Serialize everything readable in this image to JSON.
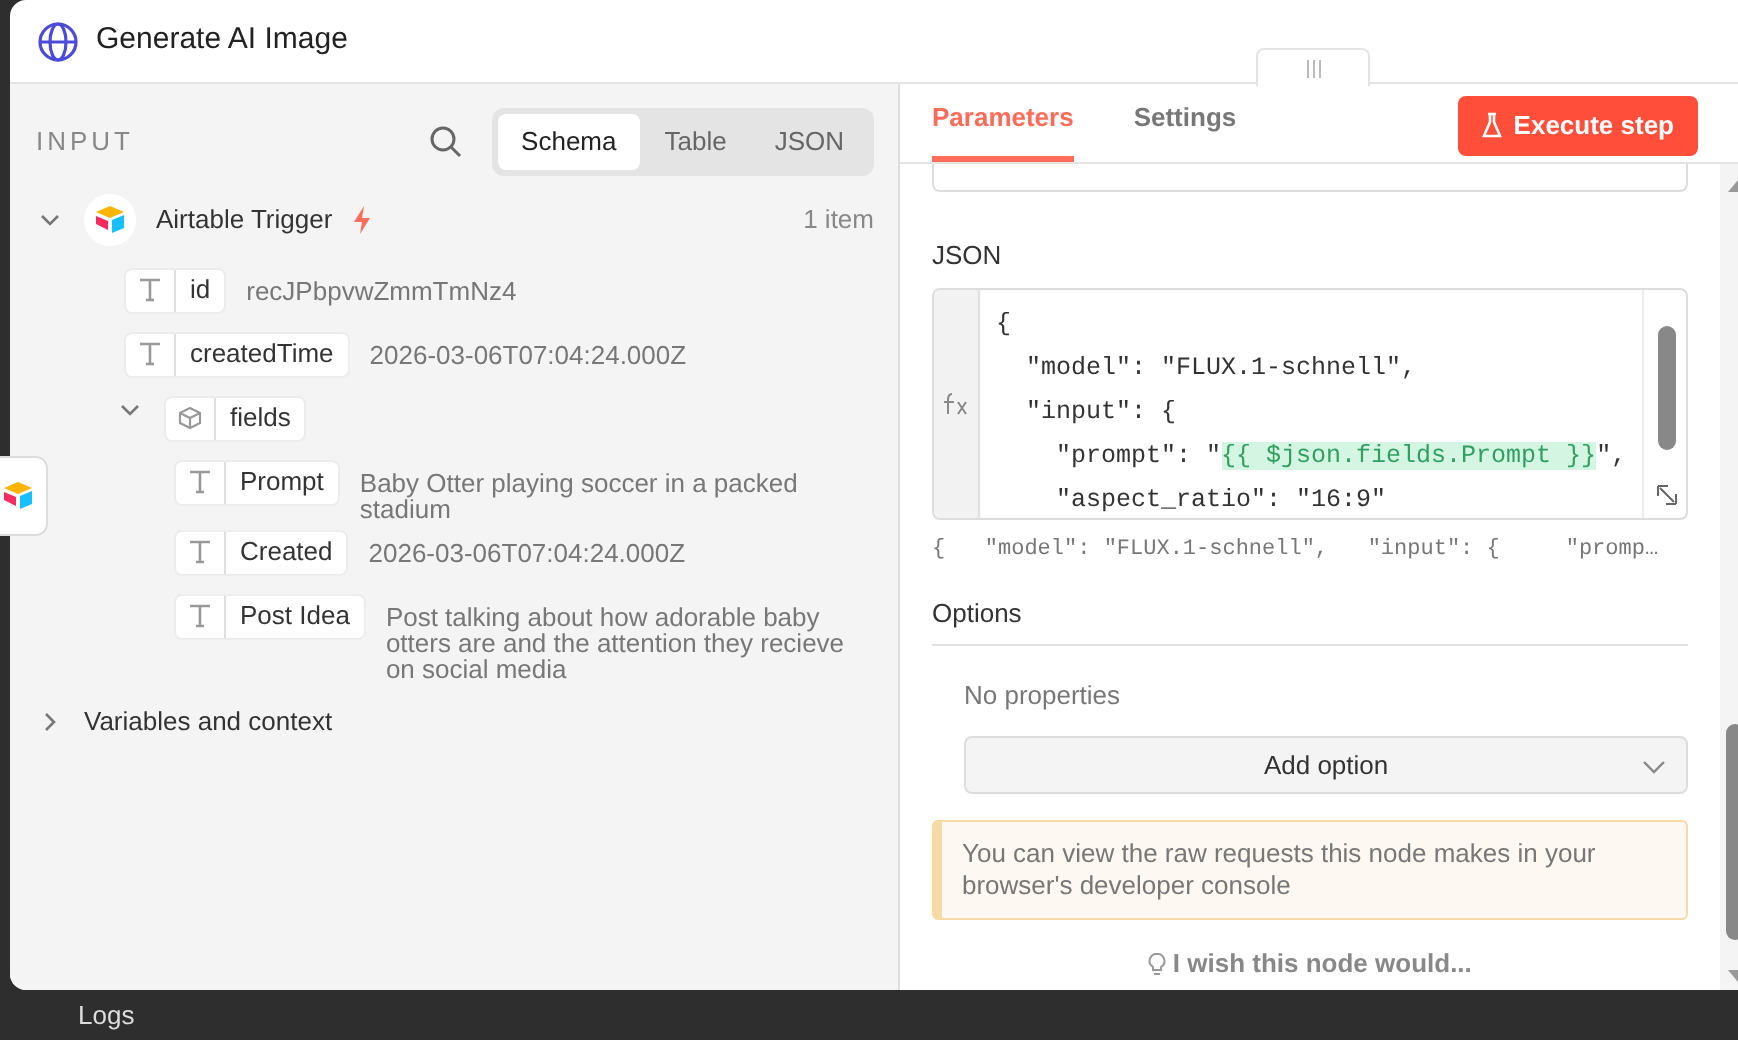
{
  "window": {
    "title": "Generate AI Image"
  },
  "input_panel": {
    "heading": "INPUT",
    "view_tabs": [
      {
        "label": "Schema",
        "selected": true
      },
      {
        "label": "Table",
        "selected": false
      },
      {
        "label": "JSON",
        "selected": false
      }
    ],
    "tree": [
      {
        "kind": "node",
        "label": "Airtable Trigger",
        "count": "1 item",
        "expanded": true,
        "children": [
          {
            "kind": "string",
            "key": "id",
            "value": "recJPbpvwZmmTmNz4"
          },
          {
            "kind": "string",
            "key": "createdTime",
            "value": "2026-03-06T07:04:24.000Z"
          },
          {
            "kind": "object",
            "key": "fields",
            "expanded": true,
            "children": [
              {
                "kind": "string",
                "key": "Prompt",
                "value": "Baby Otter playing soccer in a packed stadium"
              },
              {
                "kind": "string",
                "key": "Created",
                "value": "2026-03-06T07:04:24.000Z"
              },
              {
                "kind": "string",
                "key": "Post Idea",
                "value": "Post talking about how adorable baby otters are and the attention they recieve on social media"
              }
            ]
          }
        ]
      }
    ],
    "variables": {
      "label": "Variables and context",
      "expanded": false
    }
  },
  "parameters_panel": {
    "tabs": [
      {
        "label": "Parameters",
        "selected": true
      },
      {
        "label": "Settings",
        "selected": false
      }
    ],
    "execute_button": "Execute step",
    "json_label": "JSON",
    "code_lines": [
      [
        {
          "kind": "text",
          "text": "{"
        }
      ],
      [
        {
          "kind": "text",
          "text": "  \"model\": \"FLUX.1-schnell\","
        }
      ],
      [
        {
          "kind": "text",
          "text": "  \"input\": {"
        }
      ],
      [
        {
          "kind": "text",
          "text": "    \"prompt\": \""
        },
        {
          "kind": "expression",
          "text": "{{ $json.fields.Prompt }}"
        },
        {
          "kind": "text",
          "text": "\","
        }
      ],
      [
        {
          "kind": "text",
          "text": "    \"aspect_ratio\": \"16:9\""
        }
      ]
    ],
    "preview": "{   \"model\": \"FLUX.1-schnell\",   \"input\": {     \"promp…",
    "options": {
      "label": "Options",
      "empty": "No properties",
      "add_button": "Add option"
    },
    "notice": "You can view the raw requests this node makes in your browser's developer console",
    "feedback_link": "I wish this node would..."
  },
  "bottom_bar": {
    "label": "Logs"
  }
}
